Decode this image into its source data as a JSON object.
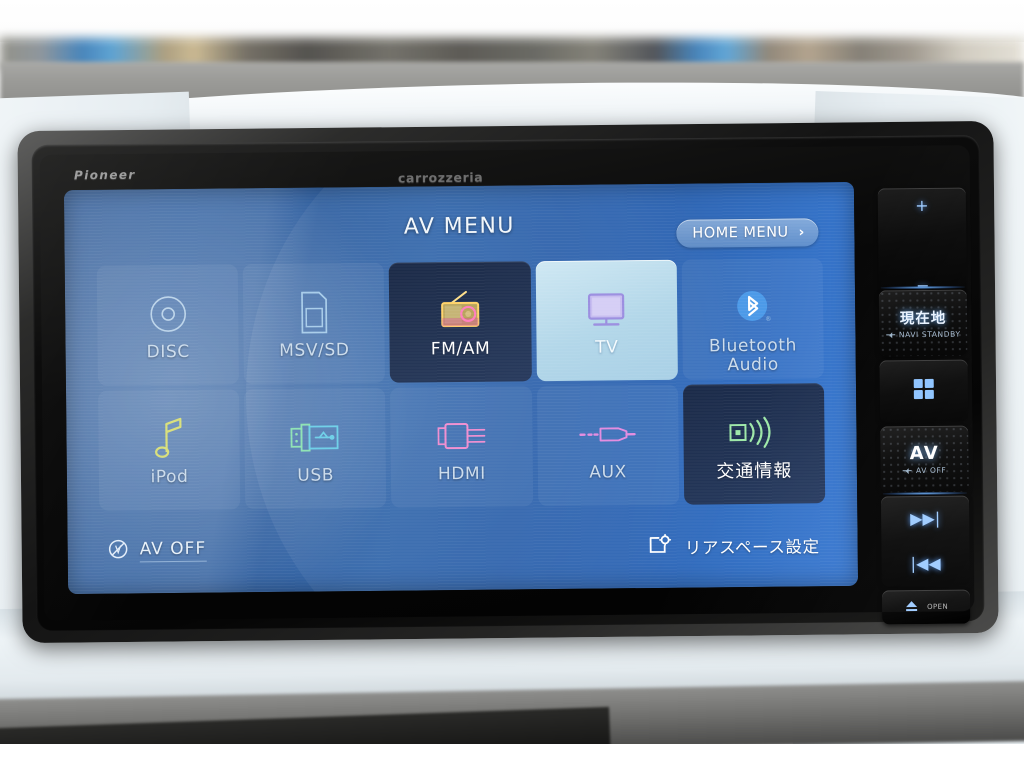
{
  "device": {
    "brand_left": "Pioneer",
    "brand_center": "carrozzeria"
  },
  "screen": {
    "title": "AV MENU",
    "home_menu": {
      "label": "HOME MENU",
      "chevron": "›",
      "icon": "chevron-right-icon"
    },
    "av_off": {
      "label": "AV OFF",
      "icon": "av-off-icon"
    },
    "rear_space": {
      "label": "リアスペース設定",
      "icon": "rear-space-settings-icon"
    },
    "tiles": [
      {
        "label": "DISC",
        "icon": "disc-icon",
        "state": "normal"
      },
      {
        "label": "MSV/SD",
        "icon": "sd-card-icon",
        "state": "normal"
      },
      {
        "label": "FM/AM",
        "icon": "radio-icon",
        "state": "dark"
      },
      {
        "label": "TV",
        "icon": "tv-icon",
        "state": "light"
      },
      {
        "label": "Bluetooth\nAudio",
        "icon": "bluetooth-icon",
        "state": "normal"
      },
      {
        "label": "iPod",
        "icon": "music-note-icon",
        "state": "normal"
      },
      {
        "label": "USB",
        "icon": "usb-icon",
        "state": "normal"
      },
      {
        "label": "HDMI",
        "icon": "hdmi-icon",
        "state": "normal"
      },
      {
        "label": "AUX",
        "icon": "aux-plug-icon",
        "state": "normal"
      },
      {
        "label": "交通情報",
        "icon": "traffic-info-icon",
        "state": "dark"
      }
    ]
  },
  "hard_keys": {
    "volume_up": "+",
    "volume_down": "−",
    "navi": {
      "label": "現在地",
      "sub": "NAVI STANDBY"
    },
    "apps": {
      "icon": "grid-apps-icon"
    },
    "av": {
      "label": "AV",
      "sub": "AV OFF"
    },
    "track_next": "▶▶|",
    "track_prev": "|◀◀",
    "eject": {
      "icon": "eject-icon",
      "label": "OPEN"
    }
  },
  "colors": {
    "screen_blue": "#3367ab",
    "tile_dark": "#24344f",
    "tile_light": "#b3d7e9",
    "accent_white": "#ffffff",
    "key_glow": "#6eb4ff"
  }
}
